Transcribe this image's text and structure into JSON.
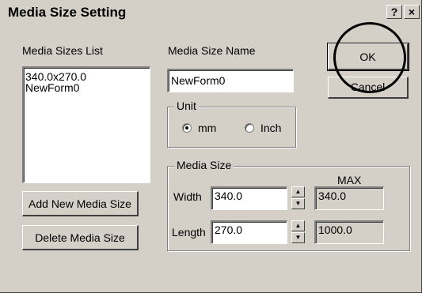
{
  "window": {
    "title": "Media Size Setting",
    "help_glyph": "?",
    "close_glyph": "×"
  },
  "media_sizes_list": {
    "label": "Media Sizes List",
    "items": [
      "340.0x270.0",
      "NewForm0"
    ]
  },
  "media_size_name": {
    "label": "Media Size Name",
    "value": "NewForm0"
  },
  "unit": {
    "label": "Unit",
    "options": [
      "mm",
      "Inch"
    ],
    "selected": "mm"
  },
  "media_size": {
    "label": "Media Size",
    "max_label": "MAX",
    "width": {
      "label": "Width",
      "value": "340.0",
      "max": "340.0"
    },
    "length": {
      "label": "Length",
      "value": "270.0",
      "max": "1000.0"
    }
  },
  "buttons": {
    "ok": "OK",
    "cancel": "Cancel",
    "add_new": "Add New Media Size",
    "delete": "Delete Media Size"
  }
}
